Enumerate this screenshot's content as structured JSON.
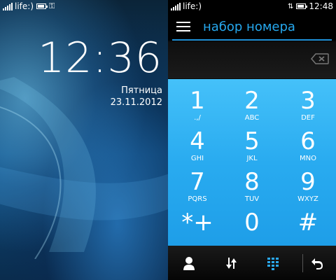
{
  "lock": {
    "status": {
      "operator": "life:)"
    },
    "time": "12:36",
    "day": "Пятница",
    "date": "23.11.2012"
  },
  "dialer": {
    "status": {
      "operator": "life:)",
      "time": "12:48"
    },
    "title": "набор номера",
    "keys": [
      {
        "num": "1",
        "letters": ".,/"
      },
      {
        "num": "2",
        "letters": "ABC"
      },
      {
        "num": "3",
        "letters": "DEF"
      },
      {
        "num": "4",
        "letters": "GHI"
      },
      {
        "num": "5",
        "letters": "JKL"
      },
      {
        "num": "6",
        "letters": "MNO"
      },
      {
        "num": "7",
        "letters": "PQRS"
      },
      {
        "num": "8",
        "letters": "TUV"
      },
      {
        "num": "9",
        "letters": "WXYZ"
      },
      {
        "num": "*+",
        "letters": ""
      },
      {
        "num": "0",
        "letters": ""
      },
      {
        "num": "#",
        "letters": ""
      }
    ],
    "toolbar": [
      "contacts-icon",
      "call-log-icon",
      "dialpad-icon",
      "back-icon"
    ],
    "accent": "#26a8ee"
  }
}
